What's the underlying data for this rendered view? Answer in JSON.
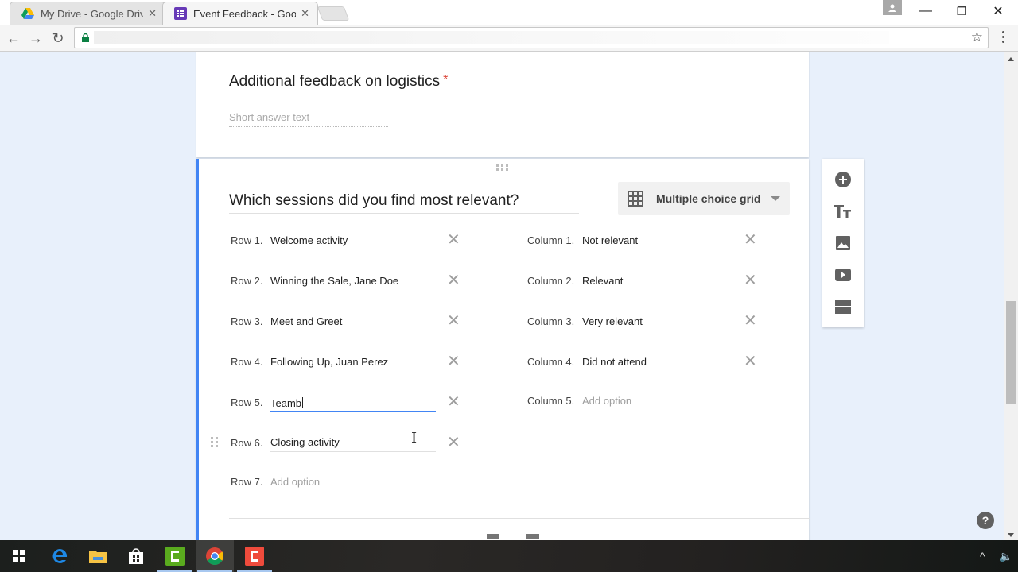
{
  "browser": {
    "tabs": [
      {
        "title": "My Drive - Google Drive",
        "icon": "google-drive-icon",
        "active": false
      },
      {
        "title": "Event Feedback - Google",
        "icon": "google-forms-icon",
        "active": true
      }
    ],
    "close_glyph": "✕",
    "window_controls": {
      "minimize": "—",
      "restore": "❐",
      "close": "✕"
    },
    "nav": {
      "back": "←",
      "forward": "→",
      "reload": "↻"
    },
    "bookmark_glyph": "☆"
  },
  "form": {
    "previous_question": {
      "title": "Additional feedback on logistics",
      "required_mark": "*",
      "placeholder": "Short answer text"
    },
    "active_question": {
      "title": "Which sessions did you find most relevant?",
      "type": "Multiple choice grid",
      "rows": [
        {
          "label": "Row 1.",
          "value": "Welcome activity",
          "placeholder": false
        },
        {
          "label": "Row 2.",
          "value": "Winning the Sale, Jane Doe",
          "placeholder": false
        },
        {
          "label": "Row 3.",
          "value": "Meet and Greet",
          "placeholder": false
        },
        {
          "label": "Row 4.",
          "value": "Following Up, Juan Perez",
          "placeholder": false
        },
        {
          "label": "Row 5.",
          "value": "Teamb",
          "placeholder": false,
          "editing": true
        },
        {
          "label": "Row 6.",
          "value": "Closing activity",
          "placeholder": false
        },
        {
          "label": "Row 7.",
          "value": "Add option",
          "placeholder": true
        }
      ],
      "columns": [
        {
          "label": "Column 1.",
          "value": "Not relevant",
          "placeholder": false
        },
        {
          "label": "Column 2.",
          "value": "Relevant",
          "placeholder": false
        },
        {
          "label": "Column 3.",
          "value": "Very relevant",
          "placeholder": false
        },
        {
          "label": "Column 4.",
          "value": "Did not attend",
          "placeholder": false
        },
        {
          "label": "Column 5.",
          "value": "Add option",
          "placeholder": true
        }
      ],
      "remove_glyph": "✕"
    }
  },
  "side_toolbar": [
    "add-question",
    "add-title",
    "add-image",
    "add-video",
    "add-section"
  ],
  "help_glyph": "?",
  "taskbar": {
    "items": [
      "start",
      "edge",
      "file-explorer",
      "store",
      "camtasia-green",
      "chrome",
      "camtasia-red"
    ],
    "tray": {
      "chevron": "^",
      "volume": "🔈"
    }
  },
  "colors": {
    "accent": "#4285f4",
    "forms_purple": "#673ab7",
    "required": "#db4437",
    "page_bg": "#e8f0fb"
  }
}
